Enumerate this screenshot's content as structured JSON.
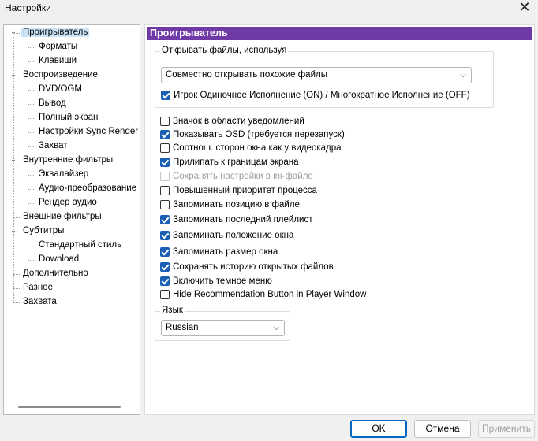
{
  "window": {
    "title": "Настройки",
    "close_glyph": "✕"
  },
  "tree": {
    "items": [
      {
        "label": "Проигрыватель",
        "level": 0,
        "expanded": true,
        "selected": true
      },
      {
        "label": "Форматы",
        "level": 1
      },
      {
        "label": "Клавиши",
        "level": 1
      },
      {
        "label": "Воспроизведение",
        "level": 0,
        "expanded": true
      },
      {
        "label": "DVD/OGM",
        "level": 1
      },
      {
        "label": "Вывод",
        "level": 1
      },
      {
        "label": "Полный экран",
        "level": 1
      },
      {
        "label": "Настройки Sync Render",
        "level": 1
      },
      {
        "label": "Захват",
        "level": 1
      },
      {
        "label": "Внутренние фильтры",
        "level": 0,
        "expanded": true
      },
      {
        "label": "Эквалайзер",
        "level": 1
      },
      {
        "label": "Аудио-преобразование",
        "level": 1
      },
      {
        "label": "Рендер аудио",
        "level": 1
      },
      {
        "label": "Внешние фильтры",
        "level": 0
      },
      {
        "label": "Субтитры",
        "level": 0,
        "expanded": true
      },
      {
        "label": "Стандартный стиль",
        "level": 1
      },
      {
        "label": "Download",
        "level": 1
      },
      {
        "label": "Дополнительно",
        "level": 0
      },
      {
        "label": "Разное",
        "level": 0
      },
      {
        "label": "Захвата",
        "level": 0
      }
    ]
  },
  "panel": {
    "header": "Проигрыватель",
    "open_files_group": {
      "legend": "Открывать файлы, используя",
      "combo_value": "Совместно открывать похожие файлы",
      "checkbox": {
        "label": "Игрок Одиночное Исполнение (ON) / Многократное Исполнение (OFF)",
        "checked": true
      }
    },
    "checkboxes": [
      {
        "label": "Значок в области уведомлений",
        "checked": false,
        "disabled": false
      },
      {
        "label": "Показывать OSD (требуется перезапуск)",
        "checked": true,
        "disabled": false
      },
      {
        "label": "Соотнош. сторон окна как у видеокадра",
        "checked": false,
        "disabled": false
      },
      {
        "label": "Прилипать к границам экрана",
        "checked": true,
        "disabled": false
      },
      {
        "label": "Сохранять настройки в ini-файле",
        "checked": false,
        "disabled": true
      },
      {
        "label": "Повышенный приоритет процесса",
        "checked": false,
        "disabled": false
      },
      {
        "label": "Запоминать позицию в файле",
        "checked": false,
        "disabled": false
      },
      {
        "label": "Запоминать последний плейлист",
        "checked": true,
        "disabled": false
      },
      {
        "label": "Запоминать положение окна",
        "checked": true,
        "disabled": false
      },
      {
        "label": "Запоминать размер окна",
        "checked": true,
        "disabled": false
      },
      {
        "label": "Сохранять историю открытых файлов",
        "checked": true,
        "disabled": false
      },
      {
        "label": "Включить темное меню",
        "checked": true,
        "disabled": false
      },
      {
        "label": "Hide Recommendation Button in Player Window",
        "checked": false,
        "disabled": false
      }
    ],
    "language_group": {
      "legend": "Язык",
      "combo_value": "Russian"
    }
  },
  "buttons": {
    "ok": "OK",
    "cancel": "Отмена",
    "apply": "Применить"
  },
  "colors": {
    "header_bg": "#6f3aa5",
    "checkbox_on": "#1a5fb4",
    "tree_selected": "#cce4f7"
  }
}
